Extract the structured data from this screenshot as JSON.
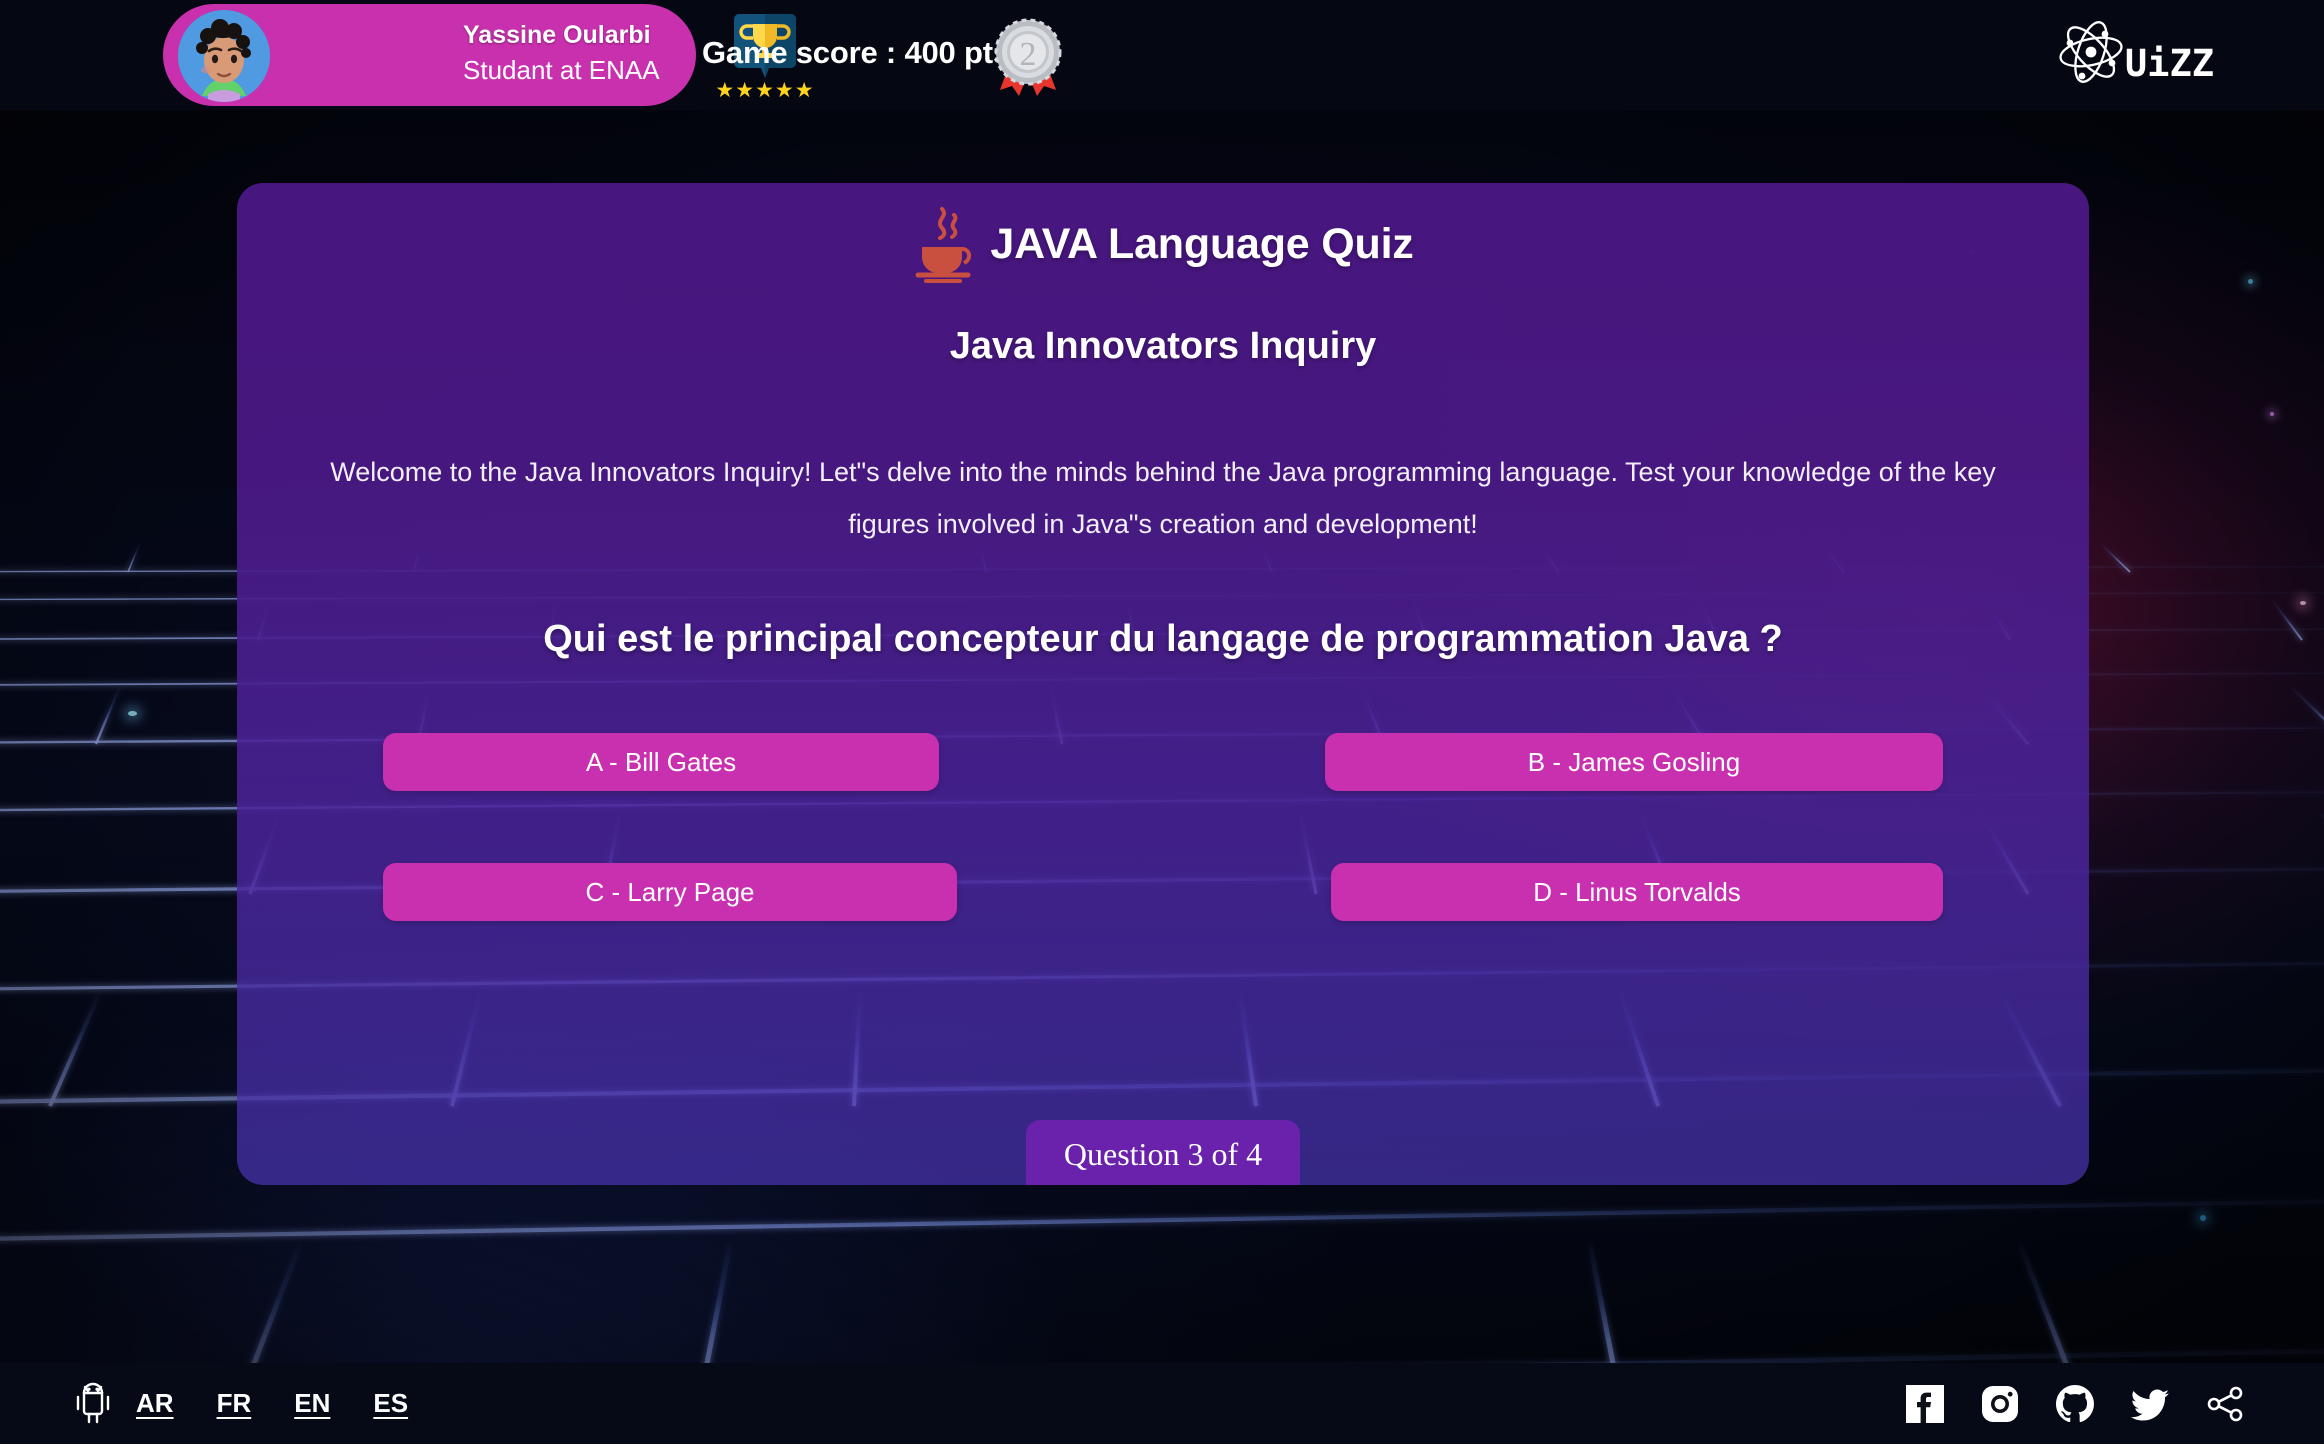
{
  "header": {
    "player": {
      "name": "Yassine Oularbi",
      "role": "Studant at ENAA",
      "avatar_icon": "avatar-curly-hair",
      "trophy_icon": "trophy-icon",
      "stars": "★★★★★",
      "star_count": 5
    },
    "score_label": "Game score : 400 pts",
    "score_value": 400,
    "rank_medal": "silver-medal-2",
    "rank_number": "2",
    "brand": {
      "name": "UiZZ",
      "logo_icon": "atom-icon"
    }
  },
  "quiz": {
    "title": "JAVA Language Quiz",
    "title_icon": "java-cup-icon",
    "subtitle": "Java Innovators Inquiry",
    "description": "Welcome to the Java Innovators Inquiry! Let\"s delve into the minds behind the Java programming language. Test your knowledge of the key figures involved in Java\"s creation and development!",
    "question": "Qui est le principal concepteur du langage de programmation Java ?",
    "answers": [
      {
        "key": "a",
        "label": "A - Bill Gates"
      },
      {
        "key": "b",
        "label": "B - James Gosling"
      },
      {
        "key": "c",
        "label": "C - Larry Page"
      },
      {
        "key": "d",
        "label": "D - Linus Torvalds"
      }
    ],
    "counter": "Question 3 of 4",
    "current_question": 3,
    "total_questions": 4
  },
  "footer": {
    "platform_icon": "android-icon",
    "languages": [
      {
        "code": "AR"
      },
      {
        "code": "FR"
      },
      {
        "code": "EN"
      },
      {
        "code": "ES"
      }
    ],
    "socials": [
      {
        "name": "facebook-icon"
      },
      {
        "name": "instagram-icon"
      },
      {
        "name": "github-icon"
      },
      {
        "name": "twitter-icon"
      },
      {
        "name": "share-icon"
      }
    ]
  },
  "colors": {
    "chip_pink": "#c930ae",
    "answer_pink": "#c930b0",
    "card_purple": "#4a1b86",
    "counter_purple": "#6a21ab",
    "bar_dark": "#050812",
    "star_gold": "#ffd21e",
    "java_red": "#c9503f"
  }
}
